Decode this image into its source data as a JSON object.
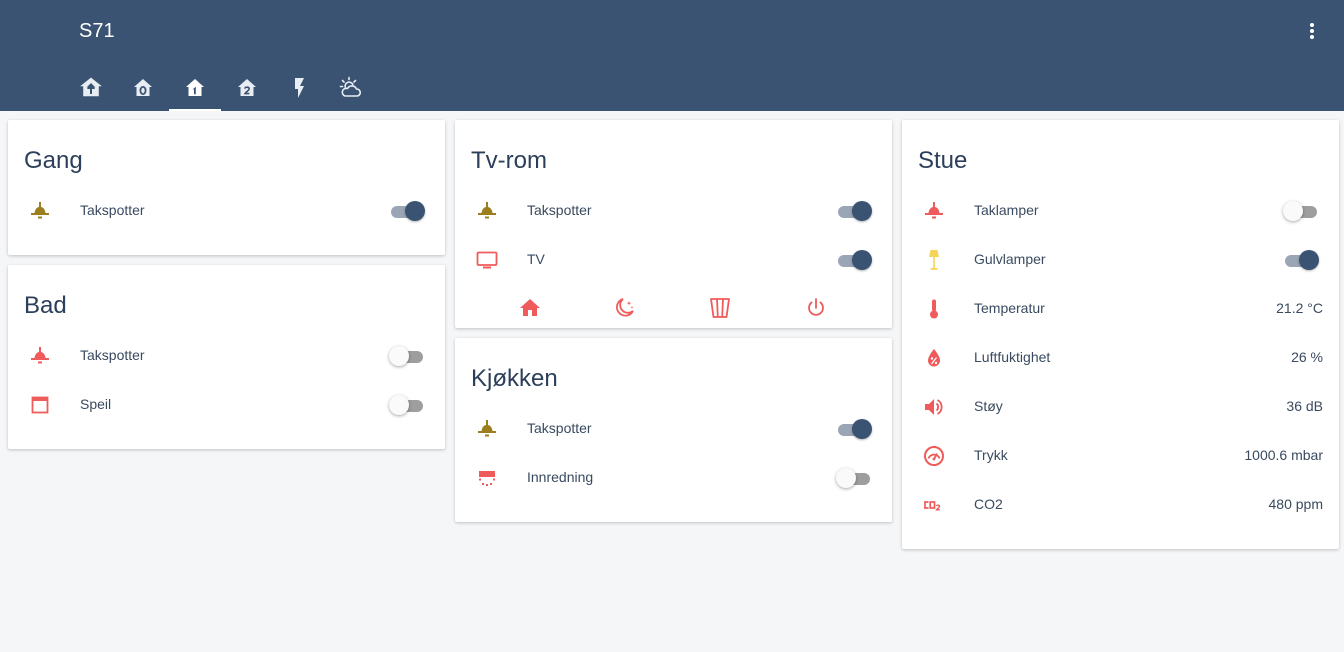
{
  "app": {
    "title": "S71"
  },
  "tabs": [
    {
      "name": "tab-overview",
      "icon": "home-group-icon",
      "active": false
    },
    {
      "name": "tab-floor-0",
      "icon": "home-floor-0-icon",
      "active": false
    },
    {
      "name": "tab-floor-1",
      "icon": "home-floor-1-icon",
      "active": true
    },
    {
      "name": "tab-floor-2",
      "icon": "home-floor-2-icon",
      "active": false
    },
    {
      "name": "tab-energy",
      "icon": "flash-icon",
      "active": false
    },
    {
      "name": "tab-weather",
      "icon": "weather-partly-cloudy-icon",
      "active": false
    }
  ],
  "cards": {
    "gang": {
      "title": "Gang",
      "rows": [
        {
          "label": "Takspotter",
          "icon": "ceiling-light-icon",
          "state": "on"
        }
      ]
    },
    "bad": {
      "title": "Bad",
      "rows": [
        {
          "label": "Takspotter",
          "icon": "ceiling-light-icon",
          "state": "off"
        },
        {
          "label": "Speil",
          "icon": "window-maximize-icon",
          "state": "off"
        }
      ]
    },
    "tvrom": {
      "title": "Tv-rom",
      "rows": [
        {
          "label": "Takspotter",
          "icon": "ceiling-light-icon",
          "state": "on"
        },
        {
          "label": "TV",
          "icon": "television-icon",
          "state": "on"
        }
      ],
      "actions": [
        {
          "name": "home-scene-button",
          "icon": "home-icon"
        },
        {
          "name": "night-scene-button",
          "icon": "weather-night-icon"
        },
        {
          "name": "movie-scene-button",
          "icon": "popcorn-icon"
        },
        {
          "name": "power-off-button",
          "icon": "power-icon"
        }
      ]
    },
    "kjokken": {
      "title": "Kjøkken",
      "rows": [
        {
          "label": "Takspotter",
          "icon": "ceiling-light-icon",
          "state": "on"
        },
        {
          "label": "Innredning",
          "icon": "led-strip-icon",
          "state": "off"
        }
      ]
    },
    "stue": {
      "title": "Stue",
      "rows": [
        {
          "label": "Taklamper",
          "icon": "ceiling-light-icon",
          "state": "off"
        },
        {
          "label": "Gulvlamper",
          "icon": "floor-lamp-icon",
          "state": "on"
        },
        {
          "label": "Temperatur",
          "icon": "thermometer-icon",
          "value": "21.2 °C"
        },
        {
          "label": "Luftfuktighet",
          "icon": "water-percent-icon",
          "value": "26 %"
        },
        {
          "label": "Støy",
          "icon": "volume-high-icon",
          "value": "36 dB"
        },
        {
          "label": "Trykk",
          "icon": "gauge-icon",
          "value": "1000.6 mbar"
        },
        {
          "label": "CO2",
          "icon": "molecule-co2-icon",
          "value": "480 ppm"
        }
      ]
    }
  },
  "colors": {
    "header": "#3b5373",
    "icon_on": "#9c7f1c",
    "icon_off": "#ef5b5b",
    "icon_lamp_on": "#f5d45a",
    "switch_on": "#3b5373"
  }
}
